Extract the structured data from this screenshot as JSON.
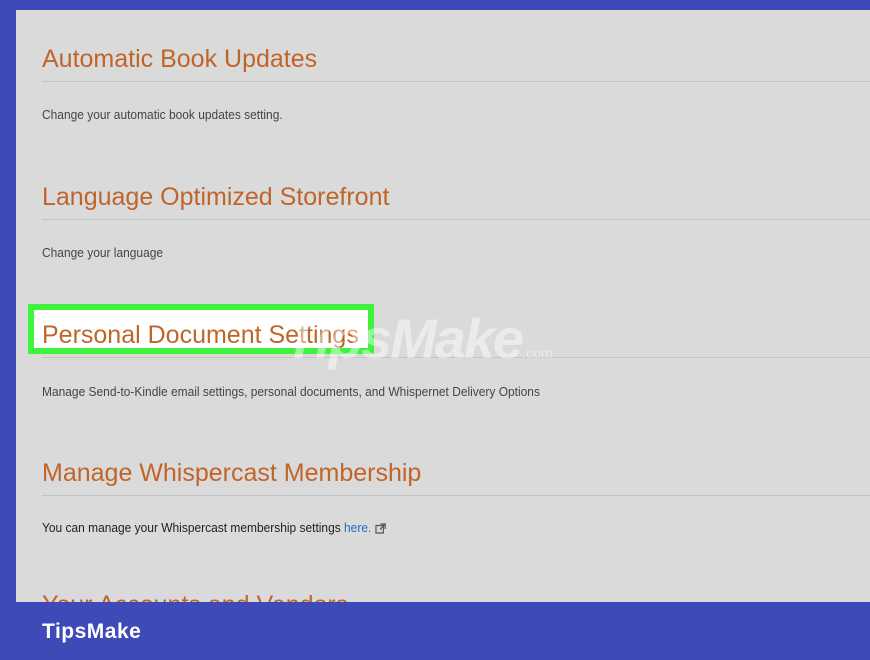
{
  "sections": [
    {
      "title": "Automatic Book Updates",
      "description": "Change your automatic book updates setting."
    },
    {
      "title": "Language Optimized Storefront",
      "description": "Change your language"
    },
    {
      "title": "Personal Document Settings",
      "description": "Manage Send-to-Kindle email settings, personal documents, and Whispernet Delivery Options"
    },
    {
      "title": "Manage Whispercast Membership",
      "description_prefix": "You can manage your Whispercast membership settings ",
      "link_text": "here.",
      "link_icon": "external-link-icon"
    }
  ],
  "next_section_partial_title": "Your Accounts and Vendors",
  "watermark": {
    "main": "TipsMake",
    "suffix": ".com"
  },
  "footer": {
    "brand": "TipsMake"
  },
  "colors": {
    "frame": "#3d4ab8",
    "title": "#c0652a",
    "highlight": "#3ef23e",
    "link": "#2a6cc2"
  }
}
